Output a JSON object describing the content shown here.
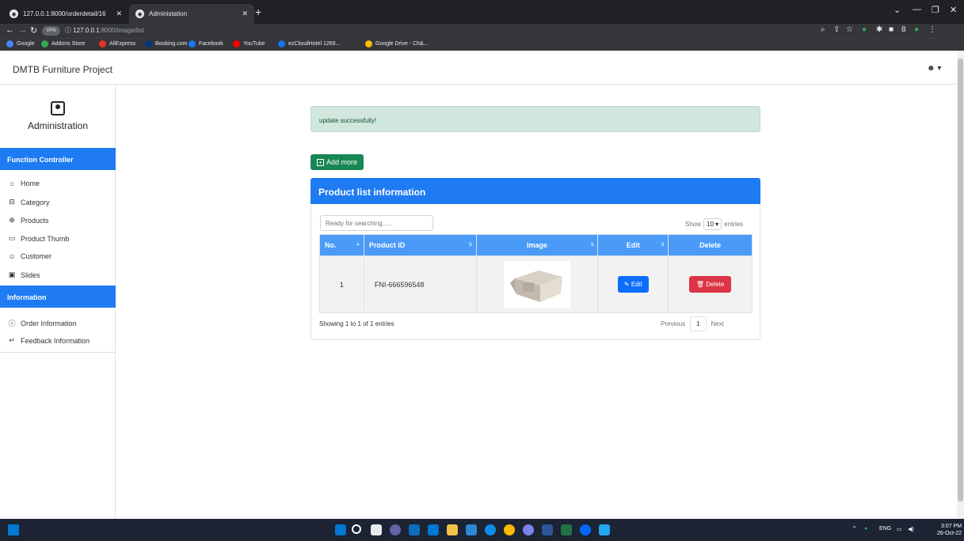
{
  "browser": {
    "tabs": [
      {
        "title": "127.0.0.1:8000/orderdetail/16",
        "active": false
      },
      {
        "title": "Administation",
        "active": true
      }
    ],
    "address": {
      "vpn_label": "VPN",
      "host": "127.0.0.1",
      "path": ":8000/image/list"
    },
    "bookmarks": [
      {
        "label": "Google",
        "color": "#4285f4"
      },
      {
        "label": "Addons Store",
        "color": "#34a853"
      },
      {
        "label": "AliExpress",
        "color": "#e43225"
      },
      {
        "label": "Booking.com",
        "color": "#003580"
      },
      {
        "label": "Facebook",
        "color": "#1877f2"
      },
      {
        "label": "YouTube",
        "color": "#ff0000"
      },
      {
        "label": "ezCloudHotel 1269...",
        "color": "#1a73e8"
      },
      {
        "label": "Google Drive - Ch&...",
        "color": "#fbbc04"
      }
    ]
  },
  "navbar": {
    "brand": "DMTB Furniture Project"
  },
  "sidebar": {
    "title": "Administration",
    "sections": [
      {
        "header": "Function Controller",
        "items": [
          {
            "label": "Home",
            "icon": "home-icon"
          },
          {
            "label": "Category",
            "icon": "category-icon"
          },
          {
            "label": "Products",
            "icon": "products-icon"
          },
          {
            "label": "Product Thumb",
            "icon": "image-icon"
          },
          {
            "label": "Customer",
            "icon": "person-icon"
          },
          {
            "label": "Slides",
            "icon": "slides-icon"
          }
        ]
      },
      {
        "header": "Information",
        "items": [
          {
            "label": "Order Information",
            "icon": "info-icon"
          },
          {
            "label": "Feedback Information",
            "icon": "feedback-icon"
          }
        ]
      }
    ]
  },
  "main": {
    "alert": "update successfully!",
    "add_button": "Add more",
    "card_title": "Product list information",
    "search_placeholder": "Ready for searching......",
    "show_label": "Show",
    "entries_value": "10",
    "entries_label": "entries",
    "table": {
      "headers": [
        "No.",
        "Product ID",
        "Image",
        "Edit",
        "Delete"
      ],
      "rows": [
        {
          "no": "1",
          "product_id": "FNI-666596548",
          "edit_label": "Edit",
          "delete_label": "Delete"
        }
      ]
    },
    "info": "Showing 1 to 1 of 1 entries",
    "pager": {
      "previous": "Previous",
      "page": "1",
      "next": "Next"
    }
  },
  "taskbar": {
    "tray_lang": "ENG",
    "time": "3:07 PM",
    "date": "26-Oct-22"
  },
  "colors": {
    "primary": "#1e7bf2",
    "success": "#198754",
    "danger": "#dc3545",
    "alert_bg": "#d1e7dd"
  }
}
